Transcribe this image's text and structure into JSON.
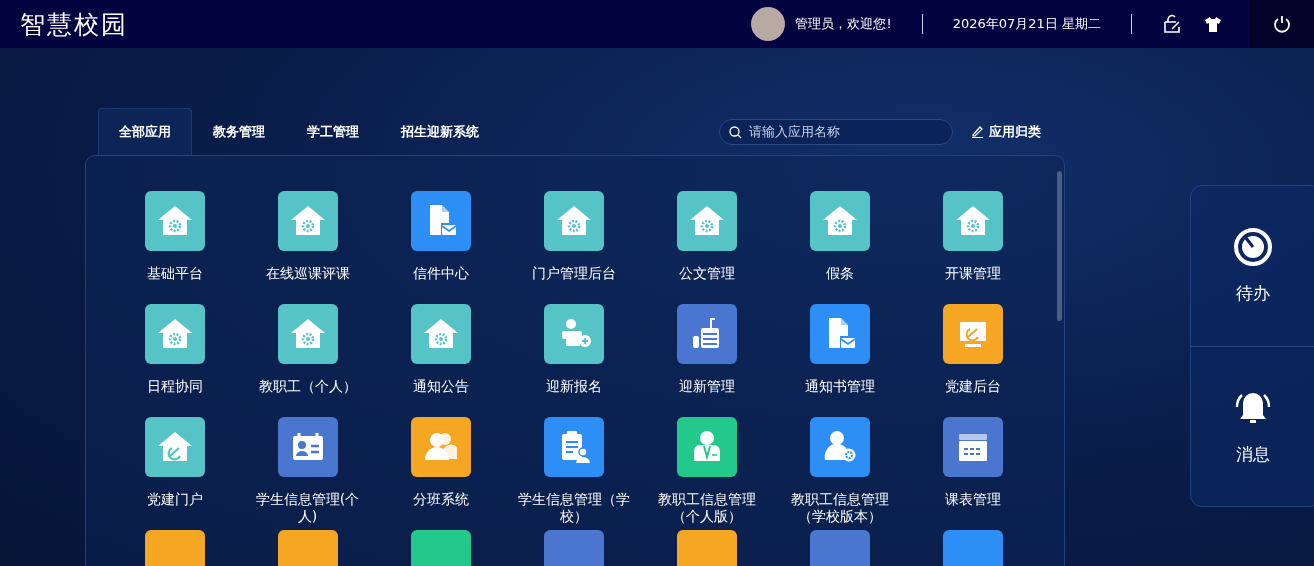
{
  "header": {
    "title": "智慧校园",
    "greeting": "管理员，欢迎您!",
    "date": "2026年07月21日 星期二"
  },
  "tabs": [
    {
      "label": "全部应用",
      "selected": true
    },
    {
      "label": "教务管理",
      "selected": false
    },
    {
      "label": "学工管理",
      "selected": false
    },
    {
      "label": "招生迎新系统",
      "selected": false
    }
  ],
  "search": {
    "placeholder": "请输入应用名称"
  },
  "classify_button": "应用归类",
  "apps": [
    {
      "label": "基础平台",
      "kind": "housegear",
      "color": "#56c4c6"
    },
    {
      "label": "在线巡课评课",
      "kind": "housegear",
      "color": "#56c4c6"
    },
    {
      "label": "信件中心",
      "kind": "docmail",
      "color": "#2d8ff5"
    },
    {
      "label": "门户管理后台",
      "kind": "housegear",
      "color": "#56c4c6"
    },
    {
      "label": "公文管理",
      "kind": "housegear",
      "color": "#56c4c6"
    },
    {
      "label": "假条",
      "kind": "housegear",
      "color": "#56c4c6"
    },
    {
      "label": "开课管理",
      "kind": "housegear",
      "color": "#56c4c6"
    },
    {
      "label": "日程协同",
      "kind": "housegear",
      "color": "#56c4c6"
    },
    {
      "label": "教职工（个人）",
      "kind": "housegear",
      "color": "#56c4c6"
    },
    {
      "label": "通知公告",
      "kind": "housegear",
      "color": "#56c4c6"
    },
    {
      "label": "迎新报名",
      "kind": "enroll",
      "color": "#56c4c6"
    },
    {
      "label": "迎新管理",
      "kind": "building",
      "color": "#4a76d0"
    },
    {
      "label": "通知书管理",
      "kind": "docmail",
      "color": "#2d8ff5"
    },
    {
      "label": "党建后台",
      "kind": "monitor",
      "color": "#f5a623"
    },
    {
      "label": "党建门户",
      "kind": "houseemblem",
      "color": "#56c4c6"
    },
    {
      "label": "学生信息管理(个人)",
      "kind": "idcard",
      "color": "#4a76d0"
    },
    {
      "label": "分班系统",
      "kind": "users",
      "color": "#f5a623"
    },
    {
      "label": "学生信息管理（学校）",
      "kind": "clipboard",
      "color": "#2d8ff5"
    },
    {
      "label": "教职工信息管理（个人版）",
      "kind": "staff",
      "color": "#22c98a"
    },
    {
      "label": "教职工信息管理（学校版本）",
      "kind": "persongear",
      "color": "#2d8ff5"
    },
    {
      "label": "课表管理",
      "kind": "calendar",
      "color": "#4a76d0"
    },
    {
      "color": "#f5a623"
    },
    {
      "color": "#f5a623"
    },
    {
      "color": "#22c98a"
    },
    {
      "color": "#4a76d0"
    },
    {
      "color": "#f5a623"
    },
    {
      "color": "#4a76d0"
    },
    {
      "color": "#2d8ff5"
    }
  ],
  "side_panel": [
    {
      "label": "待办",
      "kind": "todo"
    },
    {
      "label": "消息",
      "kind": "message"
    }
  ]
}
